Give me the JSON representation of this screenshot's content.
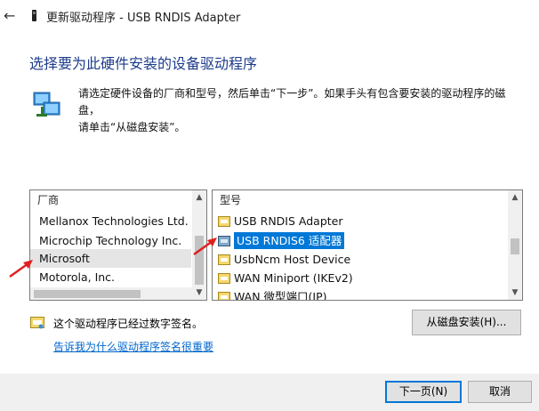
{
  "window": {
    "title": "更新驱动程序 - USB RNDIS Adapter",
    "back_icon": "←"
  },
  "heading": "选择要为此硬件安装的设备驱动程序",
  "info": {
    "line1": "请选定硬件设备的厂商和型号，然后单击“下一步”。如果手头有包含要安装的驱动程序的磁盘，",
    "line2": "请单击“从磁盘安装”。"
  },
  "manufacturer": {
    "header": "厂商",
    "items": [
      "Mellanox Technologies Ltd.",
      "Microchip Technology Inc.",
      "Microsoft",
      "Motorola, Inc."
    ],
    "selected": "Microsoft"
  },
  "model": {
    "header": "型号",
    "items": [
      "USB RNDIS Adapter",
      "USB RNDIS6 适配器",
      "UsbNcm Host Device",
      "WAN Miniport (IKEv2)",
      "WAN 微型端口(IP)"
    ],
    "selected": "USB RNDIS6 适配器"
  },
  "signed_text": "这个驱动程序已经过数字签名。",
  "signing_link": "告诉我为什么驱动程序签名很重要",
  "buttons": {
    "have_disk": "从磁盘安装(H)...",
    "next": "下一页(N)",
    "cancel": "取消"
  },
  "colors": {
    "accent": "#0078d7",
    "heading": "#1e3c8c",
    "link": "#0066cc",
    "annotation_arrow": "#e02020"
  }
}
